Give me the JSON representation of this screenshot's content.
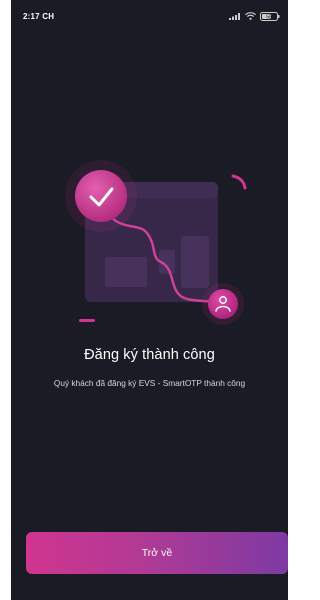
{
  "status_bar": {
    "time": "2:17 CH",
    "battery_level": "58",
    "icons": [
      "signal-icon",
      "wifi-icon",
      "battery-icon"
    ]
  },
  "main": {
    "title": "Đăng ký thành công",
    "subtitle": "Quý khách đã đăng ký EVS - SmartOTP thành công"
  },
  "footer": {
    "back_label": "Trở về"
  },
  "colors": {
    "background": "#1a1b25",
    "accent_pink": "#d0358f",
    "accent_purple": "#7d3aa3"
  }
}
